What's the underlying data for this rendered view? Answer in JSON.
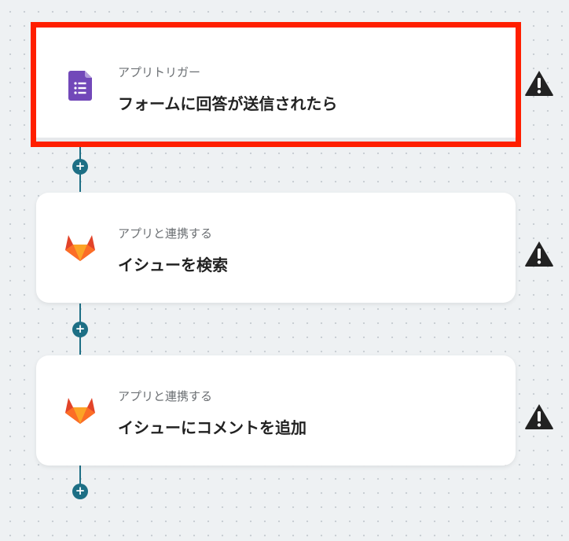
{
  "steps": [
    {
      "subtitle": "アプリトリガー",
      "title": "フォームに回答が送信されたら",
      "icon": "google-forms-icon",
      "selected": true,
      "warning": true
    },
    {
      "subtitle": "アプリと連携する",
      "title": "イシューを検索",
      "icon": "gitlab-icon",
      "selected": false,
      "warning": true
    },
    {
      "subtitle": "アプリと連携する",
      "title": "イシューにコメントを追加",
      "icon": "gitlab-icon",
      "selected": false,
      "warning": true
    }
  ],
  "add_button_symbol": "+",
  "colors": {
    "selection_outline": "#ff1f00",
    "connector": "#1d6f85",
    "forms_purple": "#7248b9",
    "gitlab_orange": "#e24329",
    "warning": "#222222"
  }
}
